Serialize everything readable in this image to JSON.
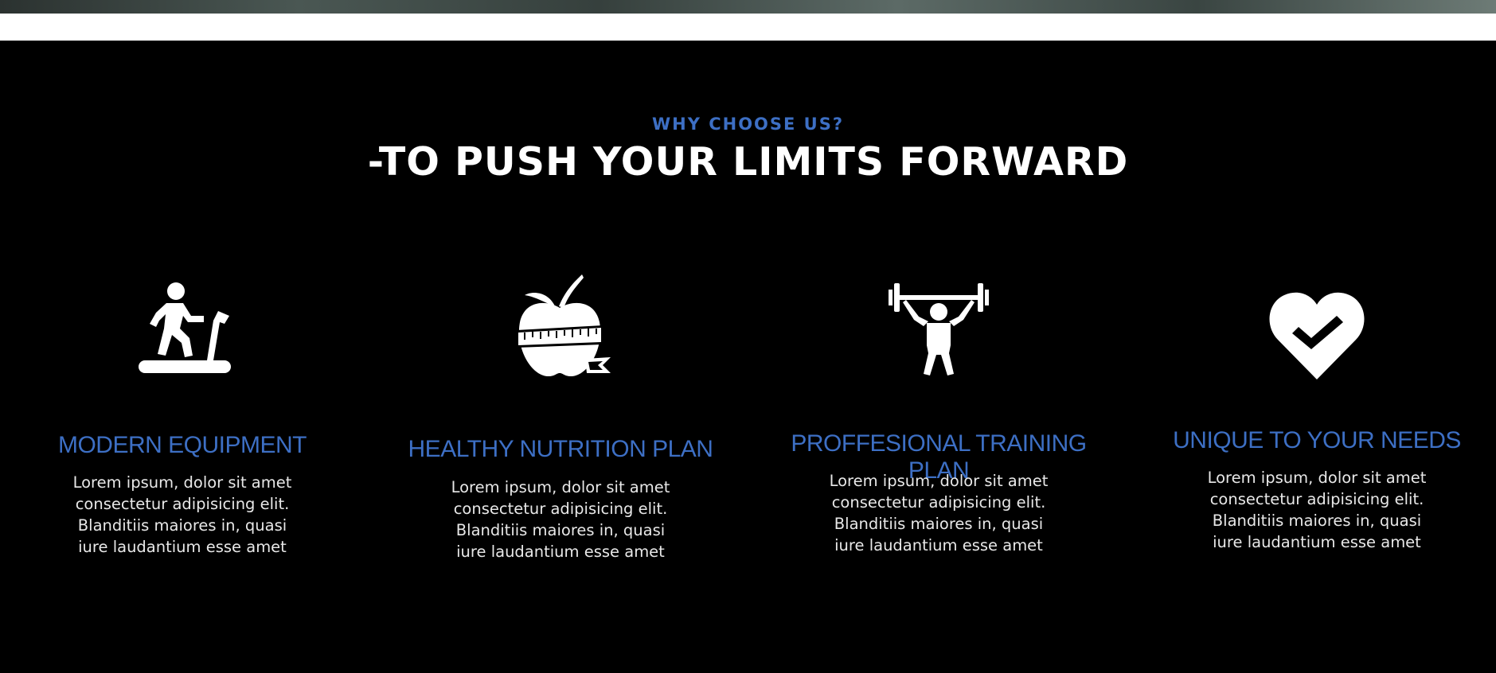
{
  "section": {
    "eyebrow": "WHY CHOOSE US?",
    "headline": "-TO PUSH YOUR LIMITS FORWARD"
  },
  "features": [
    {
      "icon": "treadmill-icon",
      "title": "MODERN EQUIPMENT",
      "text": "Lorem ipsum, dolor sit amet consectetur adipisicing elit. Blanditiis maiores in, quasi iure laudantium esse amet"
    },
    {
      "icon": "apple-measuring-tape-icon",
      "title": "HEALTHY NUTRITION PLAN",
      "text": "Lorem ipsum, dolor sit amet consectetur adipisicing elit. Blanditiis maiores in, quasi iure laudantium esse amet"
    },
    {
      "icon": "weightlifter-icon",
      "title": "PROFFESIONAL TRAINING PLAN",
      "text": "Lorem ipsum, dolor sit amet consectetur adipisicing elit. Blanditiis maiores in, quasi iure laudantium esse amet"
    },
    {
      "icon": "heart-check-icon",
      "title": "UNIQUE TO YOUR NEEDS",
      "text": "Lorem ipsum, dolor sit amet consectetur adipisicing elit. Blanditiis maiores in, quasi iure laudantium esse amet"
    }
  ],
  "colors": {
    "accent": "#3d6fc4",
    "background": "#000000",
    "text": "#ffffff"
  }
}
